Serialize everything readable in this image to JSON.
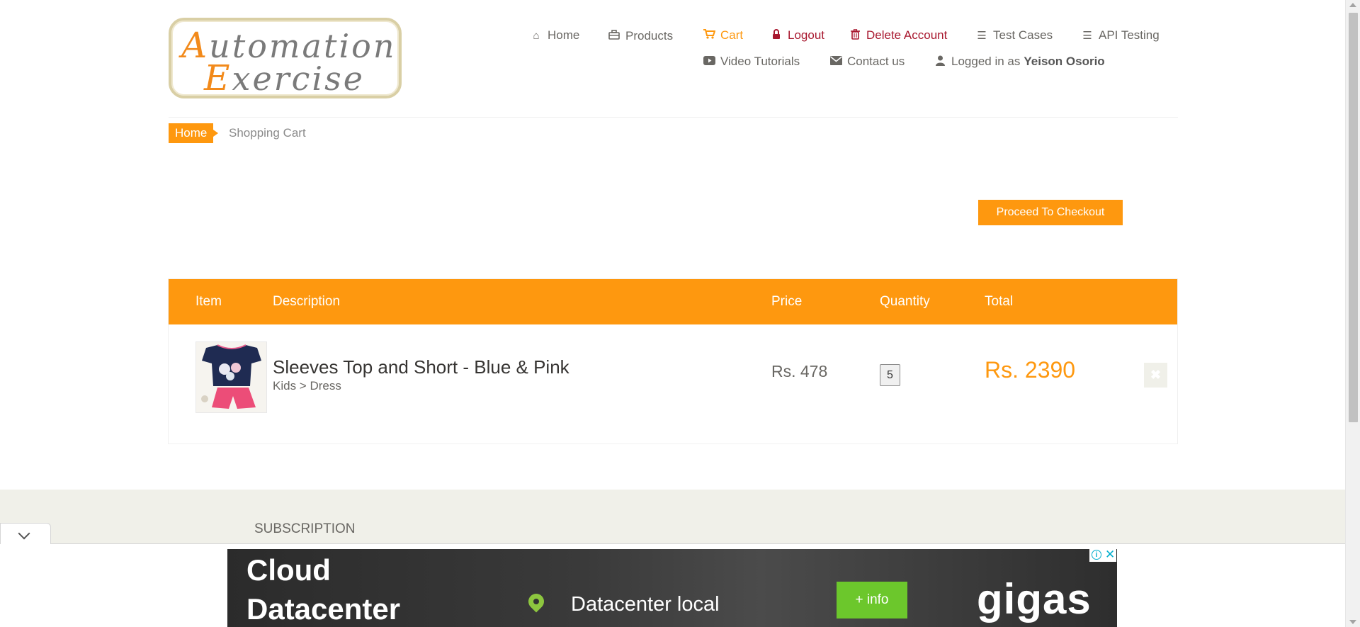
{
  "logo": {
    "line1_cap": "A",
    "line1_rest": "utomation",
    "line2_cap": "E",
    "line2_rest": "xercise"
  },
  "nav": {
    "home": "Home",
    "products": "Products",
    "cart": "Cart",
    "logout": "Logout",
    "delete_account": "Delete Account",
    "test_cases": "Test Cases",
    "api_testing": "API Testing",
    "video_tutorials": "Video Tutorials",
    "contact_us": "Contact us",
    "logged_in_as": "Logged in as",
    "username": "Yeison Osorio"
  },
  "breadcrumb": {
    "home": "Home",
    "current": "Shopping Cart"
  },
  "checkout": {
    "button_label": "Proceed To Checkout"
  },
  "cart": {
    "columns": [
      "Item",
      "Description",
      "Price",
      "Quantity",
      "Total"
    ],
    "items": [
      {
        "name": "Sleeves Top and Short - Blue & Pink",
        "category": "Kids > Dress",
        "price": "Rs. 478",
        "quantity": "5",
        "total": "Rs. 2390"
      }
    ]
  },
  "footer": {
    "subscription": "SUBSCRIPTION"
  },
  "ad": {
    "title_line1": "Cloud",
    "title_line2": "Datacenter",
    "subtitle": "Datacenter local",
    "info_button": "+ info",
    "brand": "gigas",
    "info_icon": "i",
    "close_icon": "✕"
  },
  "colors": {
    "accent": "#fe980f",
    "danger": "#a8172e",
    "footer_bg": "#f0f0e9",
    "ad_button": "#6cc72c"
  },
  "icons": {
    "home": "home-icon",
    "products": "briefcase-icon",
    "cart": "shopping-cart-icon",
    "logout": "lock-icon",
    "delete_account": "trash-icon",
    "test_cases": "list-icon",
    "api_testing": "list-icon",
    "video_tutorials": "youtube-play-icon",
    "contact_us": "envelope-icon",
    "logged_in": "user-icon",
    "delete_item": "close-icon"
  }
}
